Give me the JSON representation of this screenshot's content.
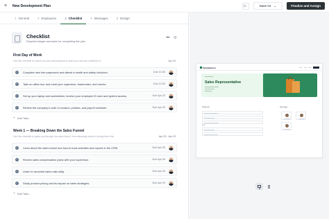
{
  "app": {
    "close_glyph": "×",
    "title": "New Development Plan",
    "save_as": "Save As",
    "save_chevron": "⌄",
    "finalize": "Finalize and Assign",
    "preview_icon": "play-icon"
  },
  "steps": [
    {
      "num": "1",
      "label": "General"
    },
    {
      "num": "2",
      "label": "Employees"
    },
    {
      "num": "3",
      "label": "Checklist"
    },
    {
      "num": "4",
      "label": "Messages"
    },
    {
      "num": "5",
      "label": "Design"
    }
  ],
  "active_step": 2,
  "checklist": {
    "title": "Checklist",
    "subtitle": "Required stages and tasks for completing this plan",
    "more_glyph": "•••",
    "settings_glyph": "⚙"
  },
  "sections": [
    {
      "title": "First Day of Work",
      "date": "Apr 23",
      "description": "Use this checklist to ensure you are well-prepared to start your role and contribute to",
      "add_task": "Add Task...",
      "tasks": [
        {
          "label": "Complete new hire paperwork and attend a health and safety induction.",
          "due": "Due 13:30"
        },
        {
          "label": "Take an office tour and meet your supervisor, teammates, and mentor.",
          "due": "Due 13:30"
        },
        {
          "label": "Set up your laptop and workstation; receive your employee ID card and system access.",
          "due": "Due Apr 23"
        },
        {
          "label": "Review the company's code of conduct, policies, and payroll schedule.",
          "due": "Due Apr 23"
        }
      ]
    },
    {
      "title": "Week 1 — Breaking Down the Sales Funnel",
      "date": "Apr 25 - Apr 29",
      "description": "Use this checklist to guide you through the sales funnel, from attracting leads to turning them into",
      "add_task": "Add Task...",
      "tasks": [
        {
          "label": "Learn about the sales funnel and how to track activities and reports in the CRM.",
          "due": "Due Apr 25"
        },
        {
          "label": "Review sales compensation plans with your supervisor.",
          "due": "Due Apr 26"
        },
        {
          "label": "Listen to recorded sales calls daily.",
          "due": "Due Apr 26"
        },
        {
          "label": "Study product pricing and its impact on sales strategies.",
          "due": "Due Apr 29"
        }
      ]
    }
  ],
  "preview": {
    "logo": "SpringSeason",
    "banner_title": "Sales Representative",
    "todo_title": "To Do List",
    "team_title": "Your Team",
    "week_label": "Week 1"
  },
  "colors": {
    "accent": "#166534",
    "primary_button": "#2d3437",
    "task_check": "#64748b",
    "preview_green": "#2d8a5c"
  }
}
